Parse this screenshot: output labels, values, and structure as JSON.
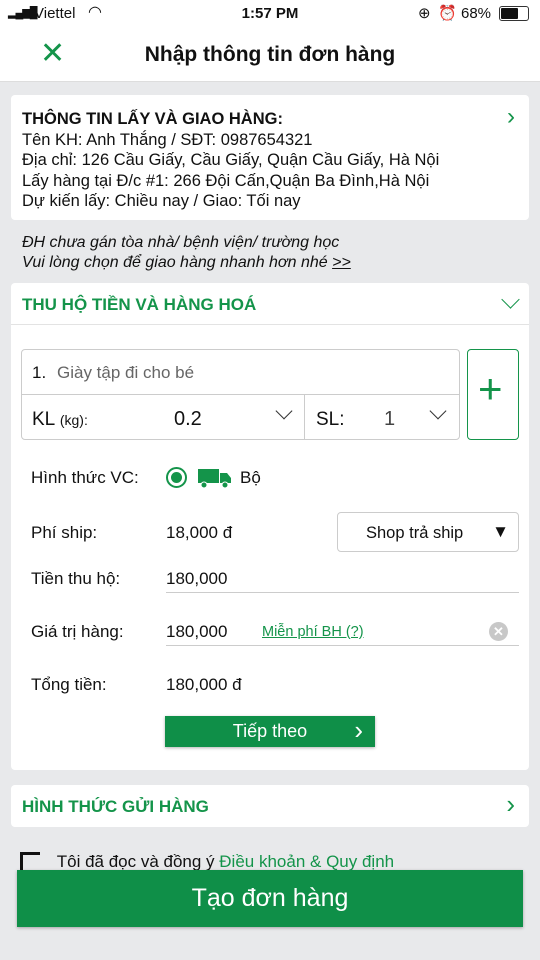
{
  "status_bar": {
    "carrier": "Viettel",
    "time": "1:57 PM",
    "battery": "68%"
  },
  "header": {
    "title": "Nhập thông tin đơn hàng",
    "close_icon": "close-icon"
  },
  "pickup_card": {
    "title": "THÔNG TIN LẤY VÀ GIAO HÀNG:",
    "lines": [
      "Tên KH: Anh Thắng / SĐT: 0987654321",
      "Địa chỉ: 126 Cầu Giấy, Cầu Giấy, Quận Cầu Giấy, Hà Nội",
      "Lấy hàng tại Đ/c #1: 266 Đội Cấn,Quận Ba Đình,Hà Nội",
      "Dự kiến lấy: Chiều nay / Giao: Tối nay"
    ]
  },
  "notice": {
    "line1": "ĐH chưa gán tòa nhà/ bệnh viện/ trường học",
    "line2": "Vui lòng chọn để giao hàng nhanh hơn nhé ",
    "link": ">>"
  },
  "cod_section": {
    "title": "THU HỘ TIỀN VÀ HÀNG HOÁ",
    "product": {
      "index": "1.",
      "name": "Giày tập đi cho bé",
      "weight_label": "KL",
      "weight_unit": "(kg):",
      "weight": "0.2",
      "qty_label": "SL:",
      "qty": "1"
    },
    "transport": {
      "label": "Hình thức VC:",
      "option": "Bộ",
      "selected": true
    },
    "ship_fee": {
      "label": "Phí ship:",
      "value": "18,000 đ",
      "payer": "Shop trả ship"
    },
    "cod": {
      "label": "Tiền thu hộ:",
      "value": "180,000"
    },
    "goods_value": {
      "label": "Giá trị hàng:",
      "value": "180,000",
      "insurance_link": "Miễn phí BH (?)"
    },
    "total": {
      "label": "Tổng tiền:",
      "value": "180,000 đ"
    },
    "next_button": "Tiếp theo"
  },
  "send_section": {
    "title": "HÌNH THỨC GỬI HÀNG"
  },
  "terms": {
    "text": "Tôi đã đọc và đồng ý ",
    "link": "Điều khoản & Quy định",
    "checked": true
  },
  "create_button": "Tạo đơn hàng",
  "colors": {
    "accent": "#0f8f48",
    "background": "#e8e9eb"
  }
}
